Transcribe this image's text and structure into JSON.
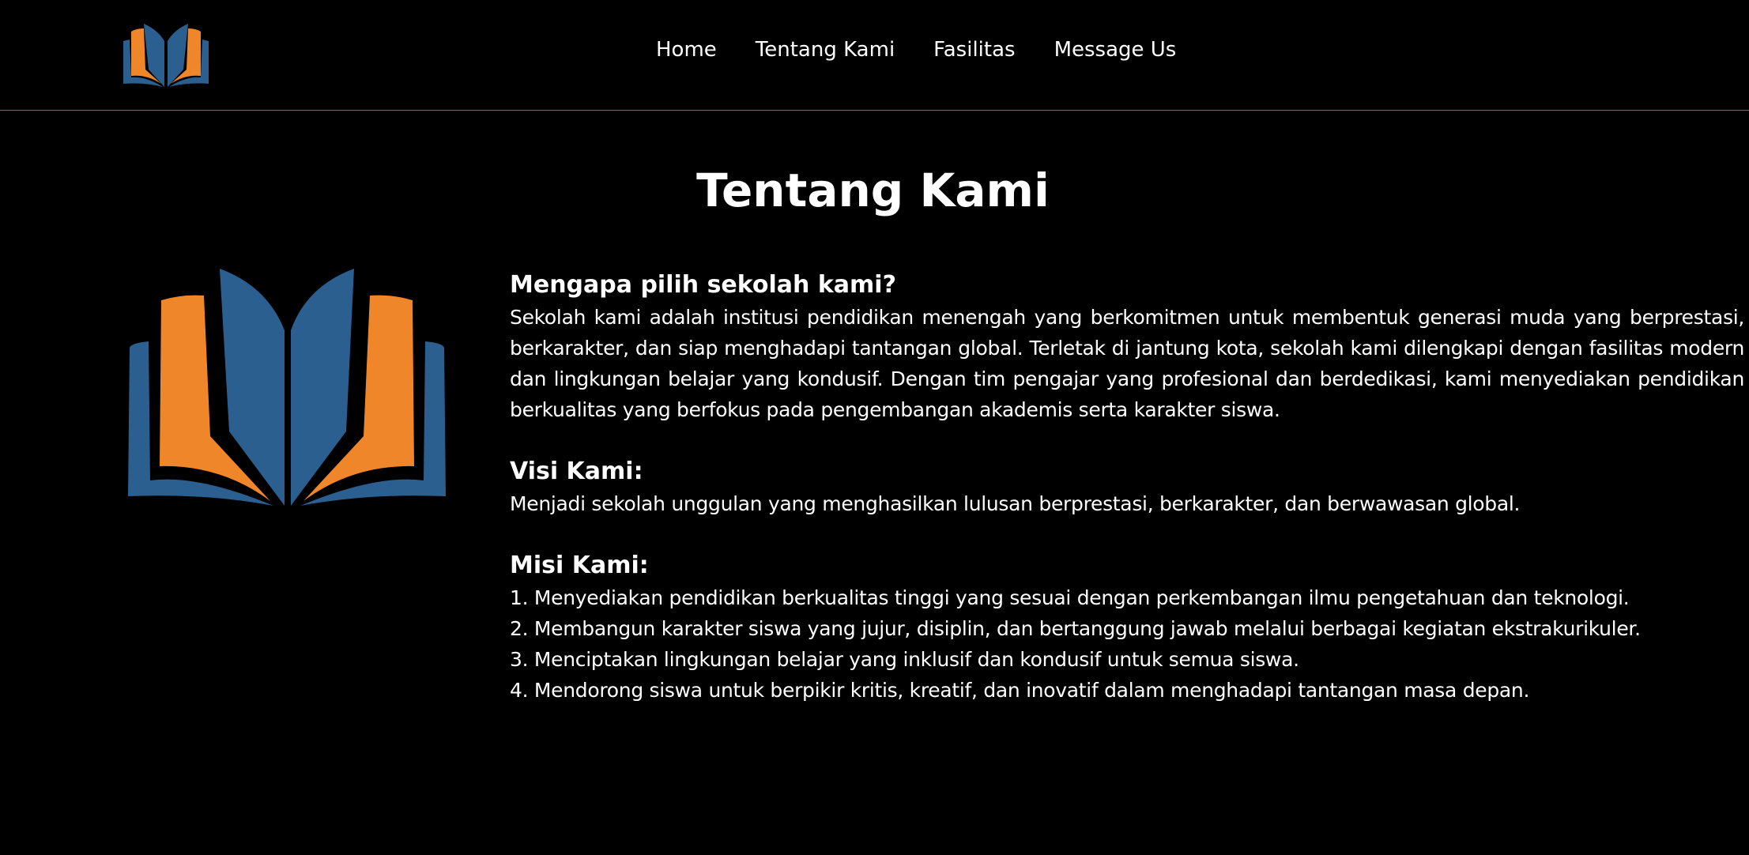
{
  "nav": {
    "logo_icon": "open-book-logo",
    "links": [
      {
        "label": "Home"
      },
      {
        "label": "Tentang Kami"
      },
      {
        "label": "Fasilitas"
      },
      {
        "label": "Message Us"
      }
    ]
  },
  "page": {
    "title": "Tentang Kami",
    "hero_icon": "open-book-logo"
  },
  "about": {
    "heading": "Mengapa pilih sekolah kami?",
    "body": "Sekolah kami adalah institusi pendidikan menengah yang berkomitmen untuk membentuk generasi muda yang berprestasi, berkarakter, dan siap menghadapi tantangan global. Terletak di jantung kota, sekolah kami dilengkapi dengan fasilitas modern dan lingkungan belajar yang kondusif. Dengan tim pengajar yang profesional dan berdedikasi, kami menyediakan pendidikan berkualitas yang berfokus pada pengembangan akademis serta karakter siswa."
  },
  "visi": {
    "heading": "Visi Kami:",
    "body": "Menjadi sekolah unggulan yang menghasilkan lulusan berprestasi, berkarakter, dan berwawasan global."
  },
  "misi": {
    "heading": "Misi Kami:",
    "items": [
      "1. Menyediakan pendidikan berkualitas tinggi yang sesuai dengan perkembangan ilmu pengetahuan dan teknologi.",
      "2. Membangun karakter siswa yang jujur, disiplin, dan bertanggung jawab melalui berbagai kegiatan ekstrakurikuler.",
      "3. Menciptakan lingkungan belajar yang inklusif dan kondusif untuk semua siswa.",
      "4. Mendorong siswa untuk berpikir kritis, kreatif, dan inovatif dalam menghadapi tantangan masa depan."
    ]
  },
  "colors": {
    "background": "#000000",
    "text": "#ffffff",
    "logo_blue": "#2a5f8f",
    "logo_orange": "#f0862a",
    "navbar_border": "#5a7a6a"
  }
}
